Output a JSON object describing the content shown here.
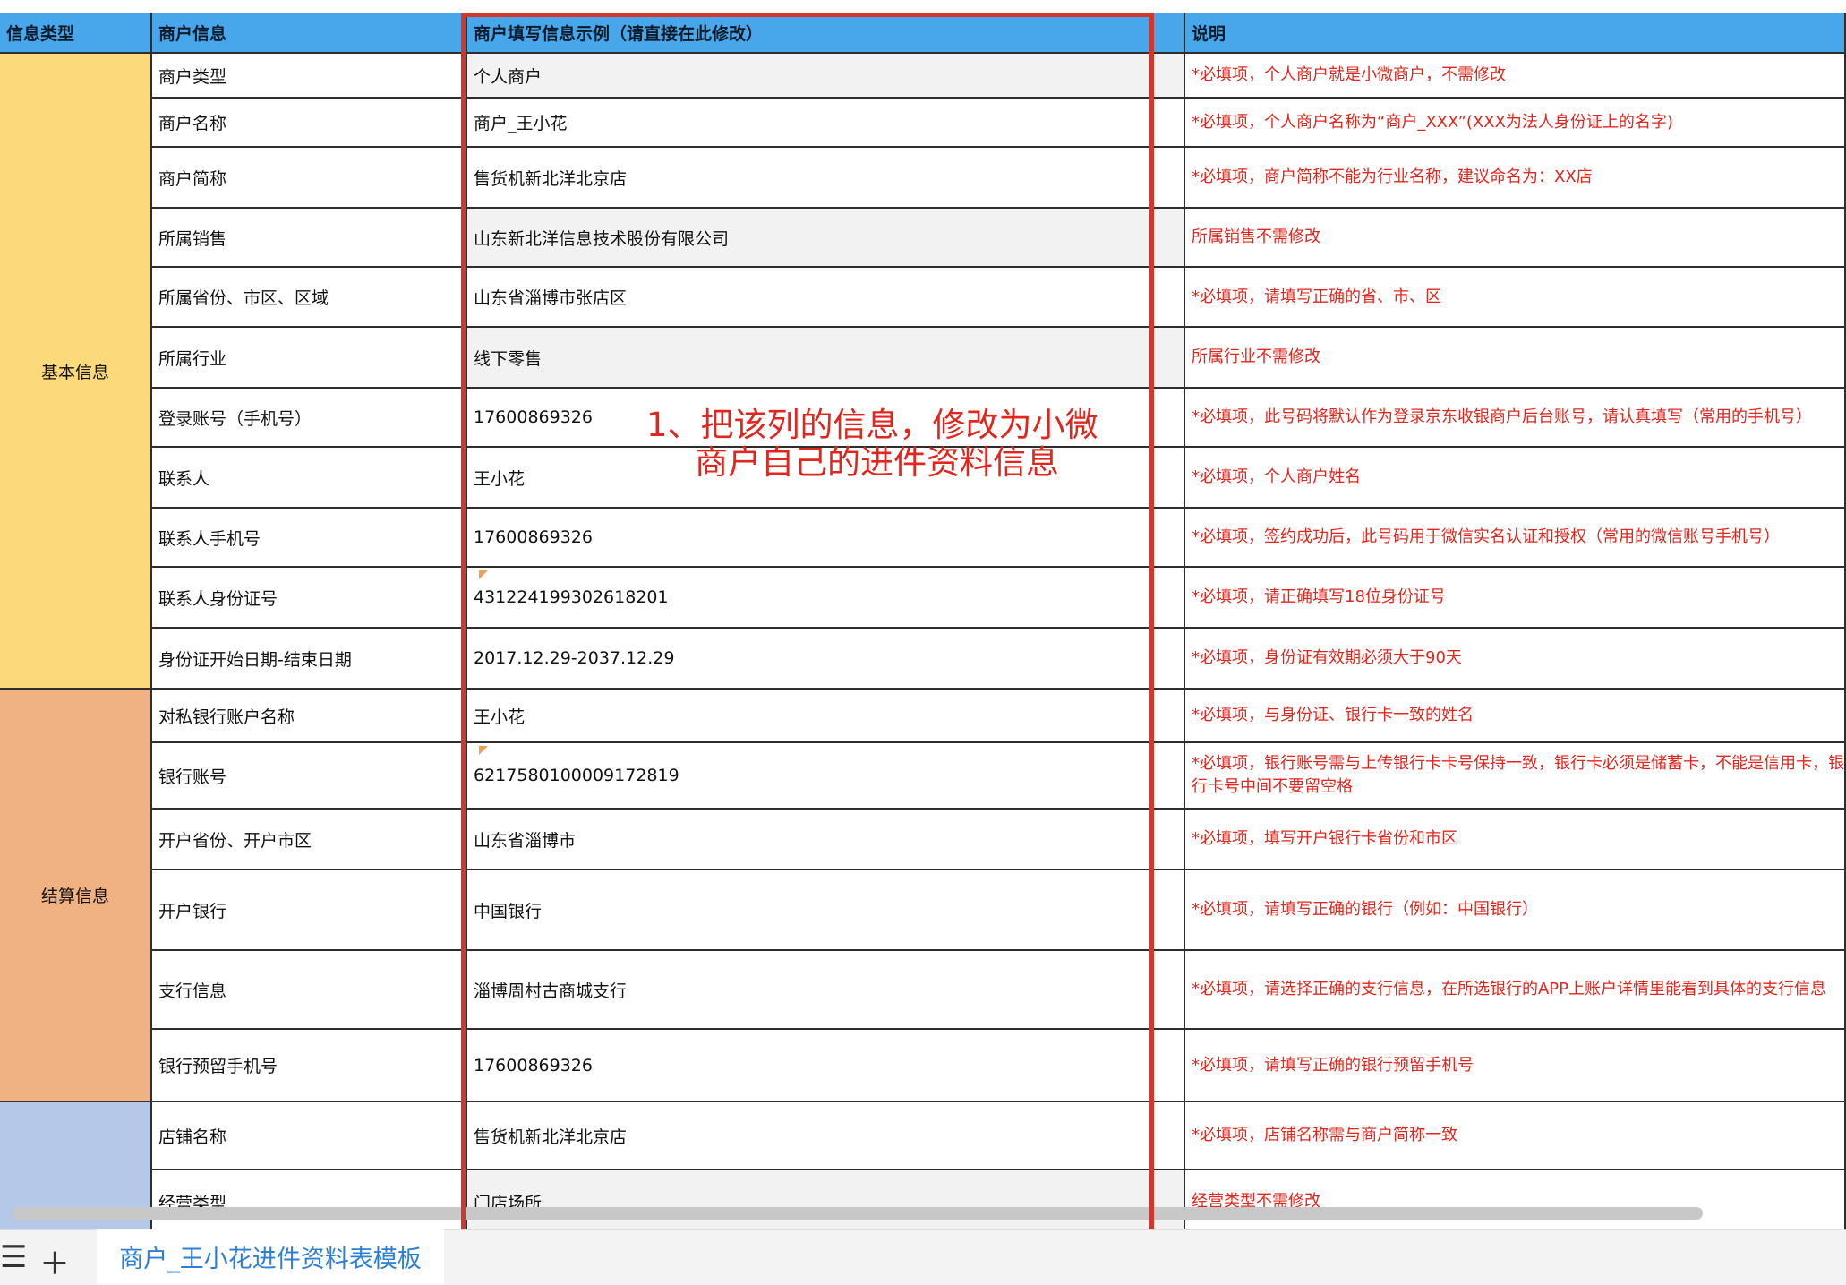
{
  "headers": [
    "信息类型",
    "商户信息",
    "商户填写信息示例（请直接在此修改）",
    "说明"
  ],
  "categories": [
    {
      "label": "基本信息"
    },
    {
      "label": "结算信息"
    },
    {
      "label": ""
    }
  ],
  "rows": [
    {
      "field": "商户类型",
      "value": "个人商户",
      "note": "*必填项，个人商户就是小微商户，不需修改"
    },
    {
      "field": "商户名称",
      "value": "商户_王小花",
      "note": "*必填项，个人商户名称为“商户_XXX”(XXX为法人身份证上的名字)"
    },
    {
      "field": "商户简称",
      "value": "售货机新北洋北京店",
      "note": "*必填项，商户简称不能为行业名称，建议命名为：XX店"
    },
    {
      "field": "所属销售",
      "value": "山东新北洋信息技术股份有限公司",
      "note": "所属销售不需修改"
    },
    {
      "field": "所属省份、市区、区域",
      "value": "山东省淄博市张店区",
      "note": "*必填项，请填写正确的省、市、区"
    },
    {
      "field": "所属行业",
      "value": "线下零售",
      "note": "所属行业不需修改"
    },
    {
      "field": "登录账号（手机号）",
      "value": "17600869326",
      "note": "*必填项，此号码将默认作为登录京东收银商户后台账号，请认真填写（常用的手机号）"
    },
    {
      "field": "联系人",
      "value": "王小花",
      "note": "*必填项，个人商户姓名"
    },
    {
      "field": "联系人手机号",
      "value": "17600869326",
      "note": "*必填项，签约成功后，此号码用于微信实名认证和授权（常用的微信账号手机号）"
    },
    {
      "field": "联系人身份证号",
      "value": "431224199302618201",
      "note": "*必填项，请正确填写18位身份证号"
    },
    {
      "field": "身份证开始日期-结束日期",
      "value": "2017.12.29-2037.12.29",
      "note": "*必填项，身份证有效期必须大于90天"
    },
    {
      "field": "对私银行账户名称",
      "value": "王小花",
      "note": "*必填项，与身份证、银行卡一致的姓名"
    },
    {
      "field": "银行账号",
      "value": "6217580100009172819",
      "note": "*必填项，银行账号需与上传银行卡卡号保持一致，银行卡必须是储蓄卡，不能是信用卡，银行卡号中间不要留空格"
    },
    {
      "field": "开户省份、开户市区",
      "value": "山东省淄博市",
      "note": "*必填项，填写开户银行卡省份和市区"
    },
    {
      "field": "开户银行",
      "value": "中国银行",
      "note": "*必填项，请填写正确的银行（例如：中国银行）"
    },
    {
      "field": "支行信息",
      "value": "淄博周村古商城支行",
      "note": "*必填项，请选择正确的支行信息，在所选银行的APP上账户详情里能看到具体的支行信息"
    },
    {
      "field": "银行预留手机号",
      "value": "17600869326",
      "note": "*必填项，请填写正确的银行预留手机号"
    },
    {
      "field": "店铺名称",
      "value": "售货机新北洋北京店",
      "note": "*必填项，店铺名称需与商户简称一致"
    },
    {
      "field": "经营类型",
      "value": "门店场所",
      "note": "经营类型不需修改"
    }
  ],
  "annotation": {
    "line1": "1、把该列的信息，修改为小微",
    "line2": "商户自己的进件资料信息"
  },
  "tabbar": {
    "menu_icon": "menu-icon",
    "add_icon": "plus-icon",
    "sheet_name": "商户_王小花进件资料表模板"
  },
  "colors": {
    "header_bg": "#47a7ea",
    "basic_bg": "#fcd97b",
    "settle_bg": "#f0b283",
    "store_bg": "#b5c8e8",
    "note_red": "#e0261d",
    "frame_red": "#d3362b"
  }
}
